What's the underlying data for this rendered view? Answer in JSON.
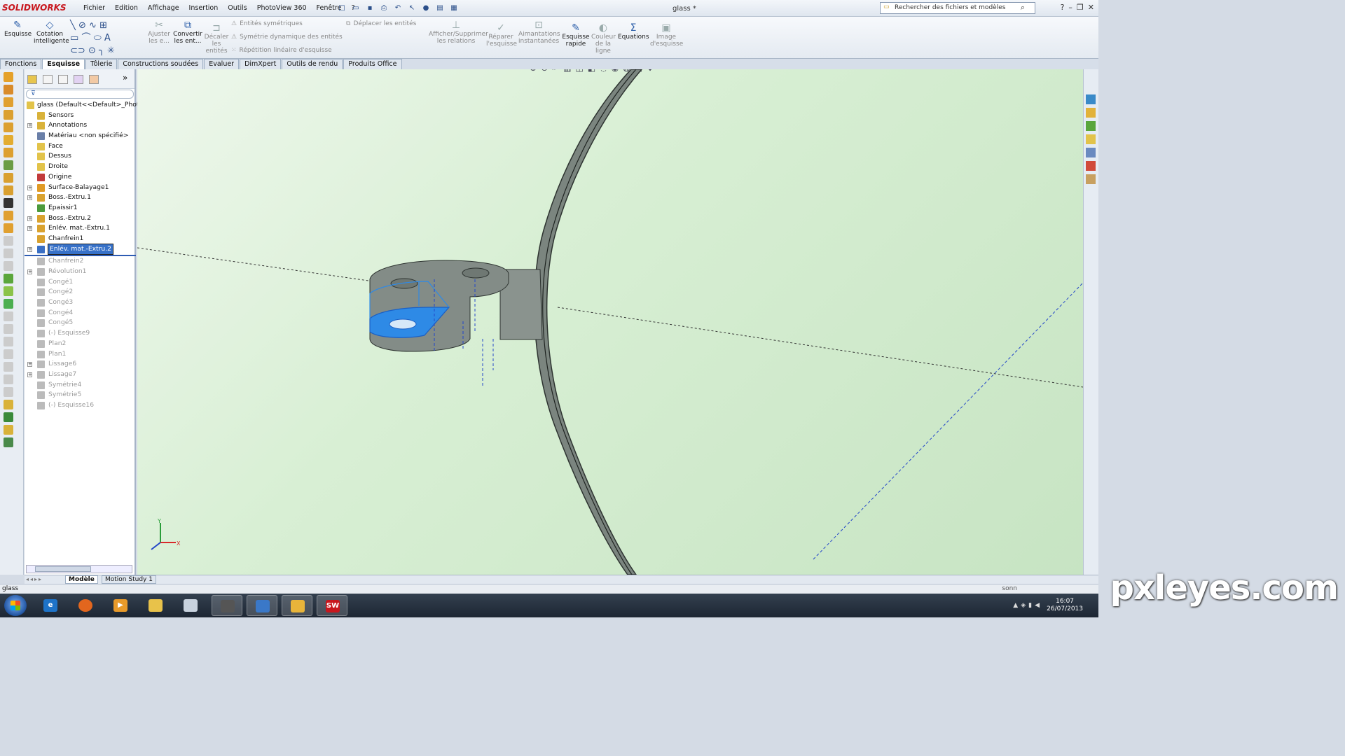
{
  "app": {
    "logo_text": "SOLIDWORKS",
    "document_title": "glass *",
    "search_placeholder": "Rechercher des fichiers et modèles"
  },
  "menu": [
    "Fichier",
    "Edition",
    "Affichage",
    "Insertion",
    "Outils",
    "PhotoView 360",
    "Fenêtre",
    "?"
  ],
  "ribbon": {
    "esquisse": "Esquisse",
    "cotation": "Cotation intelligente",
    "ajuster": "Ajuster les e...",
    "convertir": "Convertir les ent...",
    "decaler": "Décaler les entités",
    "entites_symetriques": "Entités symétriques",
    "symetrie_dynamique": "Symétrie dynamique des entités",
    "repetition_lineaire": "Répétition linéaire d'esquisse",
    "deplacer": "Déplacer les entités",
    "afficher_relations": "Afficher/Supprimer les relations",
    "reparer": "Réparer l'esquisse",
    "aimantations": "Aimantations instantanées",
    "esquisse_rapide": "Esquisse rapide",
    "couleur_ligne": "Couleur de la ligne",
    "equations": "Equations",
    "image_esquisse": "Image d'esquisse"
  },
  "tabs": [
    "Fonctions",
    "Esquisse",
    "Tôlerie",
    "Constructions soudées",
    "Evaluer",
    "DimXpert",
    "Outils de rendu",
    "Produits Office"
  ],
  "active_tab": "Esquisse",
  "tree": {
    "root": "glass  (Default<<Default>_Photo",
    "items": [
      {
        "label": "Sensors",
        "color": "#d9b23a",
        "state": "normal",
        "expandable": false
      },
      {
        "label": "Annotations",
        "color": "#d9b23a",
        "state": "normal",
        "expandable": true
      },
      {
        "label": "Matériau <non spécifié>",
        "color": "#6a7fa8",
        "state": "normal",
        "expandable": false
      },
      {
        "label": "Face",
        "color": "#e2c34a",
        "state": "normal",
        "expandable": false
      },
      {
        "label": "Dessus",
        "color": "#e2c34a",
        "state": "normal",
        "expandable": false
      },
      {
        "label": "Droite",
        "color": "#e2c34a",
        "state": "normal",
        "expandable": false
      },
      {
        "label": "Origine",
        "color": "#c23b3b",
        "state": "normal",
        "expandable": false
      },
      {
        "label": "Surface-Balayage1",
        "color": "#e09a25",
        "state": "normal",
        "expandable": true
      },
      {
        "label": "Boss.-Extru.1",
        "color": "#d9a22f",
        "state": "normal",
        "expandable": true
      },
      {
        "label": "Epaissir1",
        "color": "#4c9a3c",
        "state": "normal",
        "expandable": false
      },
      {
        "label": "Boss.-Extru.2",
        "color": "#d9a22f",
        "state": "normal",
        "expandable": true
      },
      {
        "label": "Enlév. mat.-Extru.1",
        "color": "#d9a22f",
        "state": "normal",
        "expandable": true
      },
      {
        "label": "Chanfrein1",
        "color": "#d9a22f",
        "state": "normal",
        "expandable": false
      },
      {
        "label": "Enlév. mat.-Extru.2",
        "color": "#3a6fc4",
        "state": "selected",
        "expandable": true
      },
      {
        "label": "Chanfrein2",
        "color": "#bbbbbb",
        "state": "dim",
        "expandable": false
      },
      {
        "label": "Révolution1",
        "color": "#bbbbbb",
        "state": "dim",
        "expandable": true
      },
      {
        "label": "Congé1",
        "color": "#bbbbbb",
        "state": "dim",
        "expandable": false
      },
      {
        "label": "Congé2",
        "color": "#bbbbbb",
        "state": "dim",
        "expandable": false
      },
      {
        "label": "Congé3",
        "color": "#bbbbbb",
        "state": "dim",
        "expandable": false
      },
      {
        "label": "Congé4",
        "color": "#bbbbbb",
        "state": "dim",
        "expandable": false
      },
      {
        "label": "Congé5",
        "color": "#bbbbbb",
        "state": "dim",
        "expandable": false
      },
      {
        "label": "(-) Esquisse9",
        "color": "#bbbbbb",
        "state": "dim",
        "expandable": false
      },
      {
        "label": "Plan2",
        "color": "#bbbbbb",
        "state": "dim",
        "expandable": false
      },
      {
        "label": "Plan1",
        "color": "#bbbbbb",
        "state": "dim",
        "expandable": false
      },
      {
        "label": "Lissage6",
        "color": "#bbbbbb",
        "state": "dim",
        "expandable": true
      },
      {
        "label": "Lissage7",
        "color": "#bbbbbb",
        "state": "dim",
        "expandable": true
      },
      {
        "label": "Symétrie4",
        "color": "#bbbbbb",
        "state": "dim",
        "expandable": false
      },
      {
        "label": "Symétrie5",
        "color": "#bbbbbb",
        "state": "dim",
        "expandable": false
      },
      {
        "label": "(-) Esquisse16",
        "color": "#bbbbbb",
        "state": "dim",
        "expandable": false
      }
    ]
  },
  "bottom_tabs": [
    "Modèle",
    "Motion Study 1"
  ],
  "status": {
    "left": "glass",
    "right": "sonn"
  },
  "tray": {
    "time": "16:07",
    "date": "26/07/2013"
  },
  "triad": {
    "x": "X",
    "y": "Y"
  },
  "watermark": "pxleyes.com",
  "colors": {
    "model_gray": "#7f8a85",
    "selection_blue": "#2e8ae6",
    "viewport_bg": "#d8efd4"
  }
}
